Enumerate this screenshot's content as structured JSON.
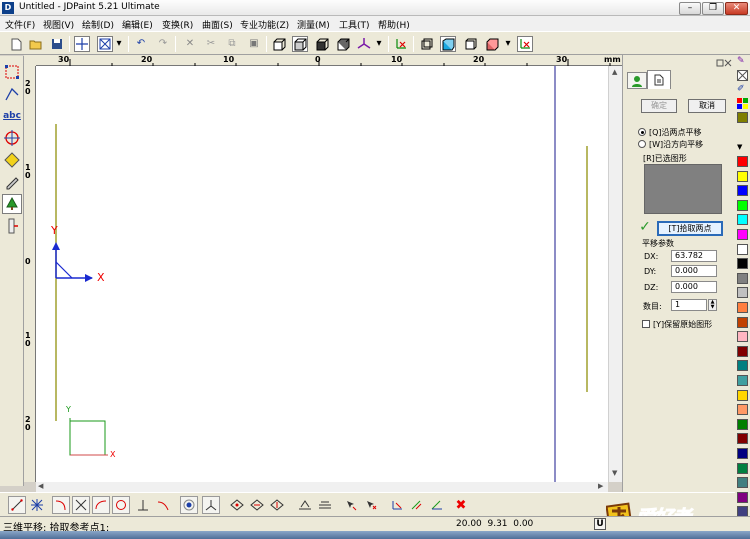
{
  "window": {
    "app_icon_letter": "D",
    "title": "Untitled - JDPaint 5.21 Ultimate",
    "min_symbol": "–",
    "max_symbol": "❐",
    "close_symbol": "✕"
  },
  "menu": [
    {
      "label": "文件(F)"
    },
    {
      "label": "视图(V)"
    },
    {
      "label": "绘制(D)"
    },
    {
      "label": "编辑(E)"
    },
    {
      "label": "变换(R)"
    },
    {
      "label": "曲面(S)"
    },
    {
      "label": "专业功能(Z)"
    },
    {
      "label": "测量(M)"
    },
    {
      "label": "工具(T)"
    },
    {
      "label": "帮助(H)"
    }
  ],
  "ruler": {
    "unit": "mm",
    "h_labels": [
      {
        "text": "30"
      },
      {
        "text": "20"
      },
      {
        "text": "10"
      },
      {
        "text": "0"
      },
      {
        "text": "10"
      },
      {
        "text": "20"
      },
      {
        "text": "30"
      }
    ],
    "v_labels": [
      {
        "text": "2\n0"
      },
      {
        "text": "1\n0"
      },
      {
        "text": "0"
      },
      {
        "text": "1\n0"
      },
      {
        "text": "2\n0"
      }
    ]
  },
  "canvas": {
    "axis_x_label": "X",
    "axis_y_label": "Y",
    "small_x_label": "X",
    "small_y_label": "Y"
  },
  "panel": {
    "tabs": [
      {
        "icon": "person-icon"
      },
      {
        "icon": "document-icon"
      }
    ],
    "confirm_label": "确定",
    "cancel_label": "取消",
    "option_two_points": "[Q]沿两点平移",
    "option_direction": "[W]沿方向平移",
    "selected_label": "[R]已选图形",
    "pick_points_label": "[T]拾取两点",
    "params_title": "平移参数",
    "dx_label": "DX:",
    "dx_value": "63.782",
    "dy_label": "DY:",
    "dy_value": "0.000",
    "dz_label": "DZ:",
    "dz_value": "0.000",
    "count_label": "数目:",
    "count_value": "1",
    "keep_original_label": "[Y]保留原始图形"
  },
  "status": {
    "prompt": "三维平移: 拾取参考点1:",
    "coords": "20.00  9.31  0.00",
    "unit_indicator": "U"
  },
  "logo": {
    "text": "爱好者"
  },
  "colors": {
    "palette": [
      "#808000",
      "#ff0000",
      "#ffff00",
      "#0000ff",
      "#00ff00",
      "#00ffff",
      "#ff00ff",
      "#ffffff",
      "#000000",
      "#808080",
      "#c0c0c0",
      "#ff8040",
      "#c04000",
      "#ffb6c1",
      "#800000",
      "#008080",
      "#40a0a0",
      "#ffd700",
      "#ff9966",
      "#008000",
      "#800000",
      "#000080",
      "#008040",
      "#408080",
      "#800080",
      "#404080"
    ]
  }
}
